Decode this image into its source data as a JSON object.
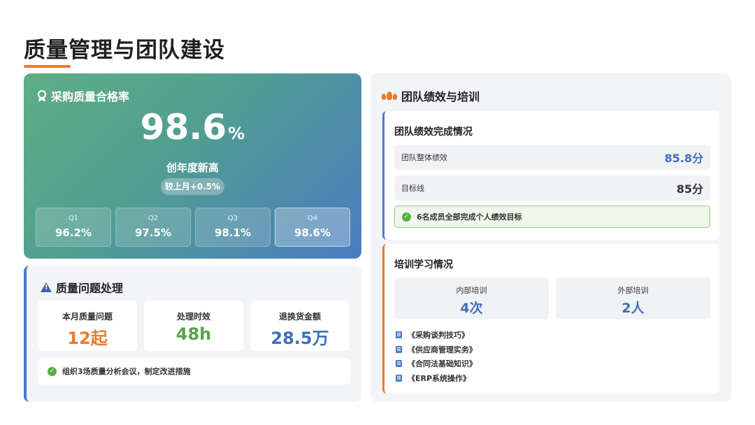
{
  "page": {
    "title": "质量管理与团队建设"
  },
  "colors": {
    "accent_orange": "#e87c2e",
    "accent_blue": "#4e7ac4",
    "accent_green": "#58ad44",
    "hero_start": "#5fae86",
    "hero_end": "#4a7cc0"
  },
  "hero": {
    "icon": "award-ribbon-icon",
    "title": "采购质量合格率",
    "value": "98.6",
    "unit": "%",
    "subtitle": "创年度新高",
    "badge": "较上月+0.5%",
    "quarters": [
      {
        "label": "Q1",
        "value": "96.2%"
      },
      {
        "label": "Q2",
        "value": "97.5%"
      },
      {
        "label": "Q3",
        "value": "98.1%"
      },
      {
        "label": "Q4",
        "value": "98.6%"
      }
    ]
  },
  "issues": {
    "icon": "warning-icon",
    "title": "质量问题处理",
    "stats": [
      {
        "label": "本月质量问题",
        "value": "12起",
        "color": "#e87c2e"
      },
      {
        "label": "处理时效",
        "value": "48h",
        "color": "#58a34a"
      },
      {
        "label": "退换货金额",
        "value": "28.5万",
        "color": "#3f6fb8"
      }
    ],
    "note": "组织3场质量分析会议，制定改进措施"
  },
  "team": {
    "icon": "team-icon",
    "title": "团队绩效与培训",
    "performance": {
      "title": "团队绩效完成情况",
      "metrics": [
        {
          "label": "团队整体绩效",
          "value": "85.8分",
          "color": "#3f6fb8"
        },
        {
          "label": "目标线",
          "value": "85分",
          "color": "#333333"
        }
      ],
      "goal_note": "6名成员全部完成个人绩效目标"
    },
    "training": {
      "title": "培训学习情况",
      "boxes": [
        {
          "label": "内部培训",
          "value": "4次"
        },
        {
          "label": "外部培训",
          "value": "2人"
        }
      ],
      "courses": [
        "《采购谈判技巧》",
        "《供应商管理实务》",
        "《合同法基础知识》",
        "《ERP系统操作》"
      ]
    }
  }
}
